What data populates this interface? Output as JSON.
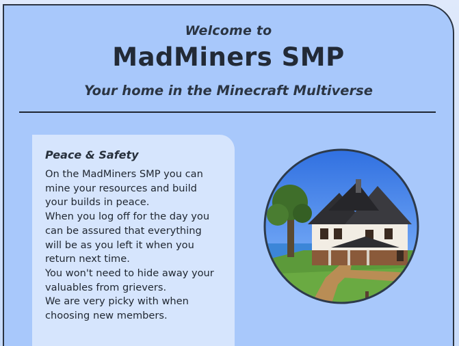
{
  "header": {
    "welcome": "Welcome to",
    "title": "MadMiners SMP",
    "subtitle": "Your home in the Minecraft Multiverse"
  },
  "peace_section": {
    "heading": "Peace & Safety",
    "lines": [
      "On the MadMiners SMP you can",
      "mine your resources and build",
      "your builds in peace.",
      "When you log off for the day you",
      "can be assured that everything",
      "will be as you left it when you",
      "return next time.",
      "You won't need to hide away your",
      "valuables from grievers.",
      "We are very picky with when",
      "choosing new members."
    ]
  },
  "colors": {
    "card_background": "#a8c8fb",
    "info_box_background": "#d6e5fd",
    "text_dark": "#222a36"
  }
}
